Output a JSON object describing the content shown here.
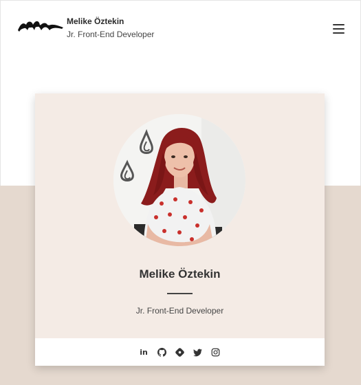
{
  "header": {
    "name": "Melike Öztekin",
    "role": "Jr. Front-End Developer",
    "logo_icon": "signature-logo",
    "menu_icon": "hamburger-menu-icon"
  },
  "card": {
    "name": "Melike Öztekin",
    "role": "Jr. Front-End Developer",
    "photo": "profile-photo",
    "social": [
      {
        "icon": "linkedin-icon",
        "glyph": "in"
      },
      {
        "icon": "github-icon"
      },
      {
        "icon": "hashnode-icon"
      },
      {
        "icon": "twitter-icon"
      },
      {
        "icon": "instagram-icon"
      }
    ]
  },
  "colors": {
    "card_bg": "#f4ebe5",
    "band_bg": "#e5d9cf",
    "text_dark": "#333333"
  }
}
